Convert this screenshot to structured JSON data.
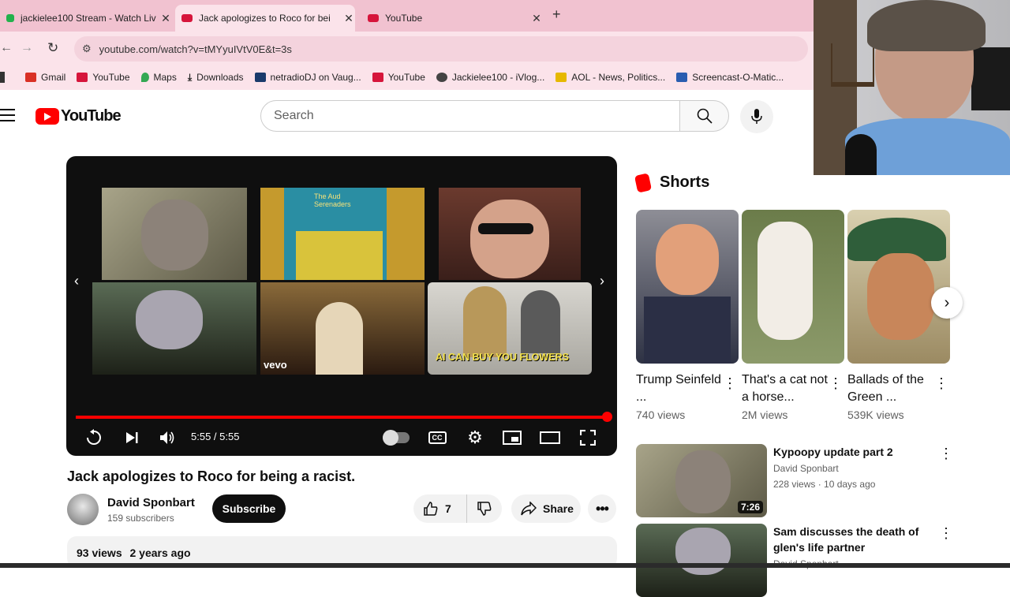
{
  "tabs": [
    {
      "title": "jackielee100 Stream - Watch Liv",
      "active": false,
      "favicon_color": "#22b14c"
    },
    {
      "title": "Jack apologizes to Roco for bei",
      "active": true,
      "favicon_color": "#d6153b"
    },
    {
      "title": "YouTube",
      "active": false,
      "favicon_color": "#d6153b"
    }
  ],
  "new_tab_glyph": "+",
  "url": "youtube.com/watch?v=tMYyuIVtV0E&t=3s",
  "bookmarks": [
    {
      "label": "Gmail",
      "icon": "gmail-icon",
      "color": "#d93025"
    },
    {
      "label": "YouTube",
      "icon": "youtube-icon",
      "color": "#d6153b"
    },
    {
      "label": "Maps",
      "icon": "maps-icon",
      "color": "#34a853"
    },
    {
      "label": "Downloads",
      "icon": "download-icon",
      "color": "#333333"
    },
    {
      "label": "netradioDJ on Vaug...",
      "icon": "vaughn-icon",
      "color": "#1a3a6b"
    },
    {
      "label": "YouTube",
      "icon": "youtube-icon",
      "color": "#d6153b"
    },
    {
      "label": "Jackielee100 - iVlog...",
      "icon": "ivlog-icon",
      "color": "#444444"
    },
    {
      "label": "AOL - News, Politics...",
      "icon": "aol-icon",
      "color": "#e6b800"
    },
    {
      "label": "Screencast-O-Matic...",
      "icon": "screencast-icon",
      "color": "#2a5db0"
    }
  ],
  "youtube": {
    "logo_text": "YouTube",
    "search_placeholder": "Search"
  },
  "player": {
    "time": "5:55 / 5:55",
    "progress": 1.0,
    "end_screen": [
      {
        "label": "",
        "color": "#6d6a55"
      },
      {
        "label": "The Aud Serenaders",
        "color": "#c59a2d"
      },
      {
        "label": "",
        "color": "#6b3a2e"
      },
      {
        "label": "",
        "color": "#4a5748"
      },
      {
        "label": "vevo",
        "color": "#6b4a2a"
      },
      {
        "label": "AI CAN BUY YOU FLOWERS",
        "color": "#c9c7c2"
      }
    ]
  },
  "video": {
    "title": "Jack apologizes to Roco for being a racist.",
    "channel": "David Sponbart",
    "subscribers": "159 subscribers",
    "subscribe_label": "Subscribe",
    "likes": "7",
    "share_label": "Share",
    "views": "93 views",
    "age": "2 years ago"
  },
  "shorts": {
    "heading": "Shorts",
    "items": [
      {
        "title": "Trump Seinfeld ...",
        "views": "740 views",
        "color": "#3b3f56"
      },
      {
        "title": "That's a cat not a horse...",
        "views": "2M views",
        "color": "#7f8a6a"
      },
      {
        "title": "Ballads of the Green ...",
        "views": "539K views",
        "color": "#4a6a4a"
      }
    ]
  },
  "related": [
    {
      "title": "Kypoopy update part 2",
      "channel": "David Sponbart",
      "meta": "228 views · 10 days ago",
      "duration": "7:26",
      "color": "#6d6a55"
    },
    {
      "title": "Sam discusses the death of glen's life partner",
      "channel": "David Sponbart",
      "meta": "",
      "duration": "",
      "color": "#4a5748"
    }
  ]
}
